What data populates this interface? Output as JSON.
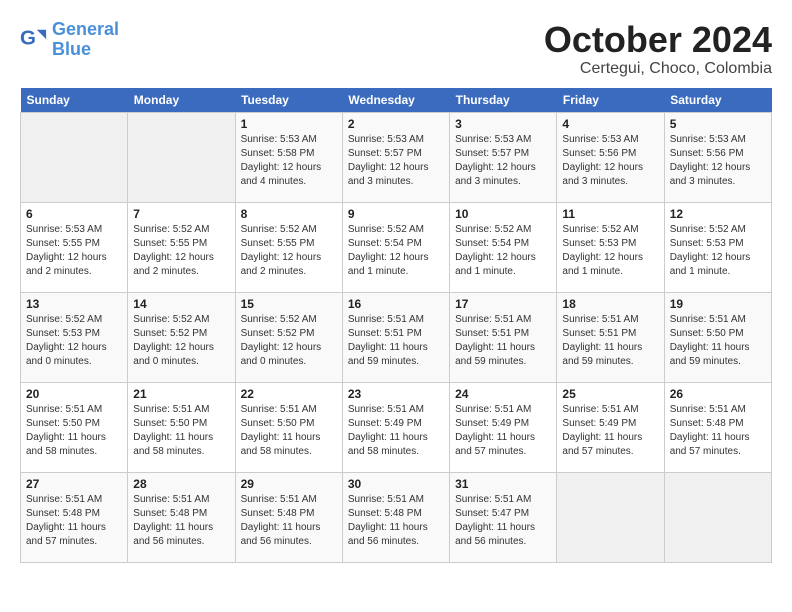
{
  "header": {
    "logo_line1": "General",
    "logo_line2": "Blue",
    "month": "October 2024",
    "location": "Certegui, Choco, Colombia"
  },
  "days_of_week": [
    "Sunday",
    "Monday",
    "Tuesday",
    "Wednesday",
    "Thursday",
    "Friday",
    "Saturday"
  ],
  "weeks": [
    [
      {
        "num": "",
        "info": ""
      },
      {
        "num": "",
        "info": ""
      },
      {
        "num": "1",
        "info": "Sunrise: 5:53 AM\nSunset: 5:58 PM\nDaylight: 12 hours and 4 minutes."
      },
      {
        "num": "2",
        "info": "Sunrise: 5:53 AM\nSunset: 5:57 PM\nDaylight: 12 hours and 3 minutes."
      },
      {
        "num": "3",
        "info": "Sunrise: 5:53 AM\nSunset: 5:57 PM\nDaylight: 12 hours and 3 minutes."
      },
      {
        "num": "4",
        "info": "Sunrise: 5:53 AM\nSunset: 5:56 PM\nDaylight: 12 hours and 3 minutes."
      },
      {
        "num": "5",
        "info": "Sunrise: 5:53 AM\nSunset: 5:56 PM\nDaylight: 12 hours and 3 minutes."
      }
    ],
    [
      {
        "num": "6",
        "info": "Sunrise: 5:53 AM\nSunset: 5:55 PM\nDaylight: 12 hours and 2 minutes."
      },
      {
        "num": "7",
        "info": "Sunrise: 5:52 AM\nSunset: 5:55 PM\nDaylight: 12 hours and 2 minutes."
      },
      {
        "num": "8",
        "info": "Sunrise: 5:52 AM\nSunset: 5:55 PM\nDaylight: 12 hours and 2 minutes."
      },
      {
        "num": "9",
        "info": "Sunrise: 5:52 AM\nSunset: 5:54 PM\nDaylight: 12 hours and 1 minute."
      },
      {
        "num": "10",
        "info": "Sunrise: 5:52 AM\nSunset: 5:54 PM\nDaylight: 12 hours and 1 minute."
      },
      {
        "num": "11",
        "info": "Sunrise: 5:52 AM\nSunset: 5:53 PM\nDaylight: 12 hours and 1 minute."
      },
      {
        "num": "12",
        "info": "Sunrise: 5:52 AM\nSunset: 5:53 PM\nDaylight: 12 hours and 1 minute."
      }
    ],
    [
      {
        "num": "13",
        "info": "Sunrise: 5:52 AM\nSunset: 5:53 PM\nDaylight: 12 hours and 0 minutes."
      },
      {
        "num": "14",
        "info": "Sunrise: 5:52 AM\nSunset: 5:52 PM\nDaylight: 12 hours and 0 minutes."
      },
      {
        "num": "15",
        "info": "Sunrise: 5:52 AM\nSunset: 5:52 PM\nDaylight: 12 hours and 0 minutes."
      },
      {
        "num": "16",
        "info": "Sunrise: 5:51 AM\nSunset: 5:51 PM\nDaylight: 11 hours and 59 minutes."
      },
      {
        "num": "17",
        "info": "Sunrise: 5:51 AM\nSunset: 5:51 PM\nDaylight: 11 hours and 59 minutes."
      },
      {
        "num": "18",
        "info": "Sunrise: 5:51 AM\nSunset: 5:51 PM\nDaylight: 11 hours and 59 minutes."
      },
      {
        "num": "19",
        "info": "Sunrise: 5:51 AM\nSunset: 5:50 PM\nDaylight: 11 hours and 59 minutes."
      }
    ],
    [
      {
        "num": "20",
        "info": "Sunrise: 5:51 AM\nSunset: 5:50 PM\nDaylight: 11 hours and 58 minutes."
      },
      {
        "num": "21",
        "info": "Sunrise: 5:51 AM\nSunset: 5:50 PM\nDaylight: 11 hours and 58 minutes."
      },
      {
        "num": "22",
        "info": "Sunrise: 5:51 AM\nSunset: 5:50 PM\nDaylight: 11 hours and 58 minutes."
      },
      {
        "num": "23",
        "info": "Sunrise: 5:51 AM\nSunset: 5:49 PM\nDaylight: 11 hours and 58 minutes."
      },
      {
        "num": "24",
        "info": "Sunrise: 5:51 AM\nSunset: 5:49 PM\nDaylight: 11 hours and 57 minutes."
      },
      {
        "num": "25",
        "info": "Sunrise: 5:51 AM\nSunset: 5:49 PM\nDaylight: 11 hours and 57 minutes."
      },
      {
        "num": "26",
        "info": "Sunrise: 5:51 AM\nSunset: 5:48 PM\nDaylight: 11 hours and 57 minutes."
      }
    ],
    [
      {
        "num": "27",
        "info": "Sunrise: 5:51 AM\nSunset: 5:48 PM\nDaylight: 11 hours and 57 minutes."
      },
      {
        "num": "28",
        "info": "Sunrise: 5:51 AM\nSunset: 5:48 PM\nDaylight: 11 hours and 56 minutes."
      },
      {
        "num": "29",
        "info": "Sunrise: 5:51 AM\nSunset: 5:48 PM\nDaylight: 11 hours and 56 minutes."
      },
      {
        "num": "30",
        "info": "Sunrise: 5:51 AM\nSunset: 5:48 PM\nDaylight: 11 hours and 56 minutes."
      },
      {
        "num": "31",
        "info": "Sunrise: 5:51 AM\nSunset: 5:47 PM\nDaylight: 11 hours and 56 minutes."
      },
      {
        "num": "",
        "info": ""
      },
      {
        "num": "",
        "info": ""
      }
    ]
  ]
}
